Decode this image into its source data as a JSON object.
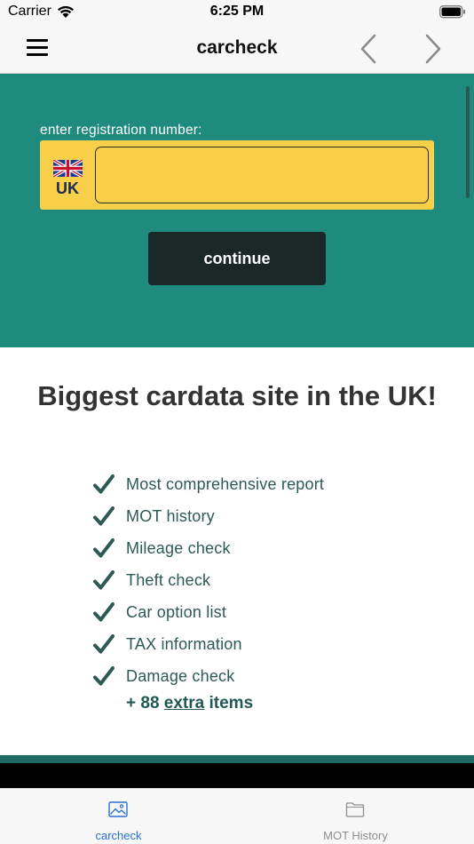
{
  "status_bar": {
    "carrier": "Carrier",
    "time": "6:25 PM",
    "icons": [
      "wifi-icon",
      "battery-icon"
    ]
  },
  "nav": {
    "title": "carcheck",
    "icons": [
      "menu-icon",
      "back-icon",
      "forward-icon"
    ]
  },
  "hero": {
    "label": "enter registration number:",
    "country_code": "UK",
    "input_value": "",
    "input_placeholder": "",
    "continue_label": "continue",
    "colors": {
      "background": "#1f8a7e",
      "plate": "#f8cf48",
      "button": "#1a2727"
    }
  },
  "content": {
    "headline": "Biggest cardata site in the UK!",
    "features": [
      "Most comprehensive report",
      "MOT history",
      "Mileage check",
      "Theft check",
      "Car option list",
      "TAX information",
      "Damage check"
    ],
    "extra": {
      "prefix": "+ 88 ",
      "link": "extra",
      "suffix": " items"
    }
  },
  "tab_bar": {
    "tabs": [
      {
        "label": "carcheck",
        "icon": "image-icon",
        "active": true
      },
      {
        "label": "MOT History",
        "icon": "folder-icon",
        "active": false
      }
    ],
    "colors": {
      "active": "#2a6fd6",
      "inactive": "#8e8e8e"
    }
  }
}
